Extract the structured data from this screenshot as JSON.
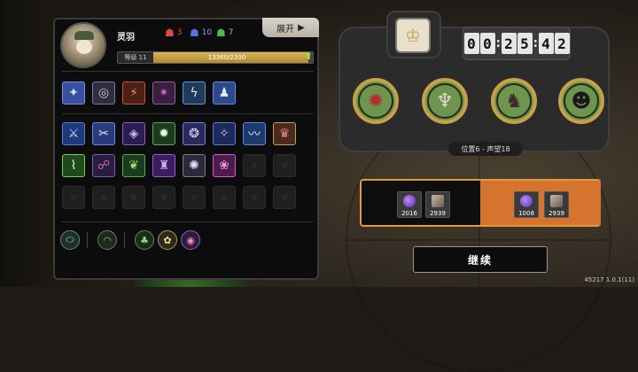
{
  "player": {
    "name": "灵羽",
    "level_label": "等级 11",
    "exp_text": "13360/2200",
    "exp_fraction": 0.97
  },
  "resources": [
    {
      "icon": "red-mask-icon",
      "glyph": "☗",
      "color": "#e04848",
      "value": "3"
    },
    {
      "icon": "blue-mask-icon",
      "glyph": "☗",
      "color": "#5a6ee8",
      "value": "10"
    },
    {
      "icon": "green-mask-icon",
      "glyph": "☗",
      "color": "#52b84a",
      "value": "7"
    }
  ],
  "expand_label": "展开",
  "timer": [
    "0",
    "0",
    "2",
    "5",
    "4",
    "2"
  ],
  "position_label": "位置6 - 声望18",
  "rewards_left": [
    {
      "icon": "purple-orb-icon",
      "value": "2016",
      "color": "#7a3cd8"
    },
    {
      "icon": "stone-block-icon",
      "value": "2939",
      "color": "#8a7a6a"
    }
  ],
  "rewards_right": [
    {
      "icon": "purple-orb-icon",
      "value": "1008",
      "color": "#7a3cd8"
    },
    {
      "icon": "stone-block-icon",
      "value": "2939",
      "color": "#8a7a6a"
    }
  ],
  "continue_label": "继续",
  "version": "45217 1.0.1(11)",
  "colors": {
    "accent_orange": "#d4742f",
    "enemy_ring": "#c8a04a",
    "exp_fill": "#c9a048"
  }
}
